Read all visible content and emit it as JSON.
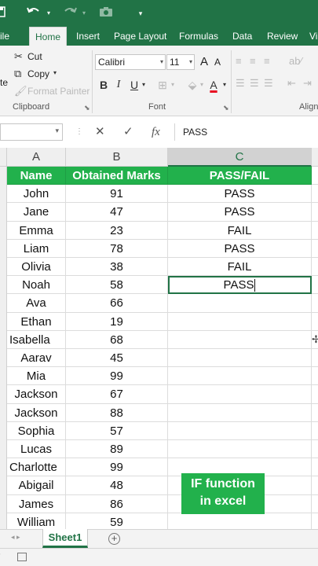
{
  "qat": {
    "save_icon": "save-icon",
    "undo_icon": "undo-icon",
    "redo_icon": "redo-icon",
    "camera_icon": "camera-icon",
    "customize_icon": "customize-qat-icon"
  },
  "tabs": [
    "ile",
    "Home",
    "Insert",
    "Page Layout",
    "Formulas",
    "Data",
    "Review",
    "Vi"
  ],
  "ribbon": {
    "clipboard": {
      "paste_partial": "te",
      "cut": "Cut",
      "copy": "Copy",
      "format_painter": "Format Painter",
      "label": "Clipboard"
    },
    "font": {
      "font_name": "Calibri",
      "font_size": "11",
      "bold": "B",
      "italic": "I",
      "underline": "U",
      "grow": "A",
      "shrink": "A",
      "font_color": "A",
      "label": "Font"
    },
    "alignment": {
      "label": "Align"
    }
  },
  "formula_bar": {
    "name_box": "",
    "cancel": "✕",
    "enter": "✓",
    "fx": "fx",
    "value": "PASS"
  },
  "columns": [
    "A",
    "B",
    "C"
  ],
  "table": {
    "headers": [
      "Name",
      "Obtained Marks",
      "PASS/FAIL"
    ],
    "rows": [
      [
        "John",
        "91",
        "PASS"
      ],
      [
        "Jane",
        "47",
        "PASS"
      ],
      [
        "Emma",
        "23",
        "FAIL"
      ],
      [
        "Liam",
        "78",
        "PASS"
      ],
      [
        "Olivia",
        "38",
        "FAIL"
      ],
      [
        "Noah",
        "58",
        "PASS"
      ],
      [
        "Ava",
        "66",
        ""
      ],
      [
        "Ethan",
        "19",
        ""
      ],
      [
        "Isabella",
        "68",
        ""
      ],
      [
        "Aarav",
        "45",
        ""
      ],
      [
        "Mia",
        "99",
        ""
      ],
      [
        "Jackson",
        "67",
        ""
      ],
      [
        "Jackson",
        "88",
        ""
      ],
      [
        "Sophia",
        "57",
        ""
      ],
      [
        "Lucas",
        "89",
        ""
      ],
      [
        "Charlotte",
        "99",
        ""
      ],
      [
        "Abigail",
        "48",
        ""
      ],
      [
        "James",
        "86",
        ""
      ],
      [
        "William",
        "59",
        ""
      ]
    ]
  },
  "badge": {
    "line1": "IF function",
    "line2": "in excel"
  },
  "sheets": {
    "active": "Sheet1",
    "add_icon": "add-sheet-icon"
  },
  "colors": {
    "excel_green": "#217346",
    "header_fill": "#22b14c"
  }
}
